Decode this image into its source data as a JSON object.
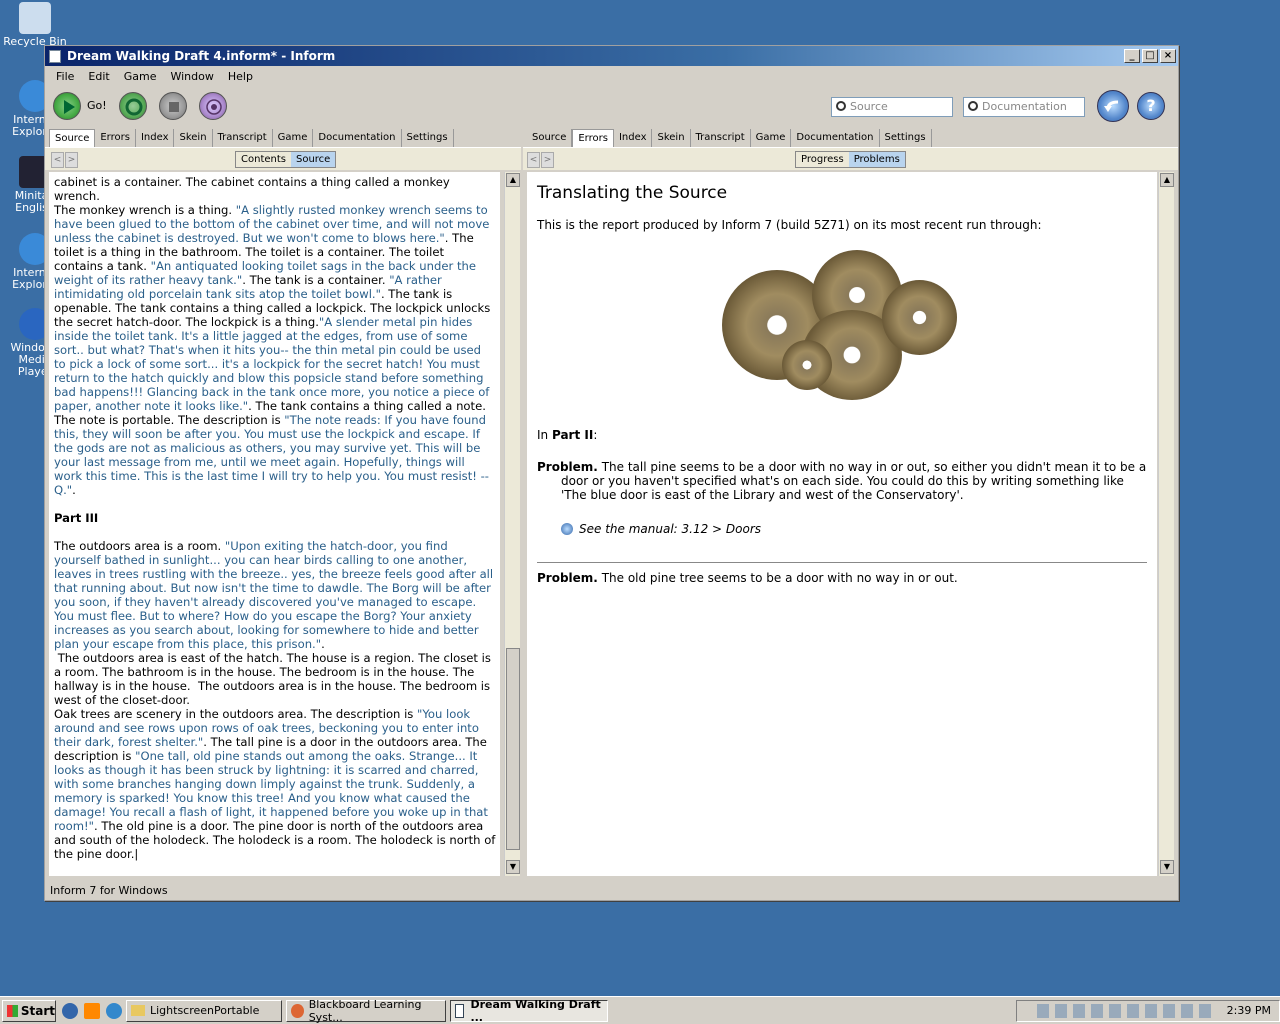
{
  "desktop": {
    "icons": [
      {
        "label": "Recycle Bin"
      },
      {
        "label": "Internet Explorer"
      },
      {
        "label": "Minitab English"
      },
      {
        "label": "Internet Explorer"
      },
      {
        "label": "Windows Media Player"
      }
    ]
  },
  "window": {
    "title": "Dream Walking Draft 4.inform* - Inform",
    "controls": {
      "minimize": "_",
      "maximize": "□",
      "close": "×"
    }
  },
  "menu": [
    "File",
    "Edit",
    "Game",
    "Window",
    "Help"
  ],
  "toolbar": {
    "go_label": "Go!",
    "search_source_placeholder": "Source",
    "search_docs_placeholder": "Documentation"
  },
  "left_pane": {
    "tabs": [
      "Source",
      "Errors",
      "Index",
      "Skein",
      "Transcript",
      "Game",
      "Documentation",
      "Settings"
    ],
    "active_tab": "Source",
    "segments": [
      "Contents",
      "Source"
    ],
    "active_segment": "Source"
  },
  "right_pane": {
    "tabs": [
      "Source",
      "Errors",
      "Index",
      "Skein",
      "Transcript",
      "Game",
      "Documentation",
      "Settings"
    ],
    "active_tab": "Errors",
    "segments": [
      "Progress",
      "Problems"
    ],
    "active_segment": "Problems"
  },
  "source_text": [
    {
      "t": "cabinet is a container. The cabinet contains a thing called a monkey wrench.\nThe monkey wrench is a thing. ",
      "q": false
    },
    {
      "t": "\"A slightly rusted monkey wrench seems to have been glued to the bottom of the cabinet over time, and will not move unless the cabinet is destroyed. But we won't come to blows here.\"",
      "q": true
    },
    {
      "t": ". The toilet is a thing in the bathroom. The toilet is a container. The toilet contains a tank. ",
      "q": false
    },
    {
      "t": "\"An antiquated looking toilet sags in the back under the weight of its rather heavy tank.\"",
      "q": true
    },
    {
      "t": ". The tank is a container. ",
      "q": false
    },
    {
      "t": "\"A rather intimidating old porcelain tank sits atop the toilet bowl.\"",
      "q": true
    },
    {
      "t": ". The tank is openable. The tank contains a thing called a lockpick. The lockpick unlocks the secret hatch-door. The lockpick is a thing.",
      "q": false
    },
    {
      "t": "\"A slender metal pin hides inside the toilet tank. It's a little jagged at the edges, from use of some sort.. but what? That's when it hits you-- the thin metal pin could be used to pick a lock of some sort... it's a lockpick for the secret hatch! You must return to the hatch quickly and blow this popsicle stand before something bad happens!!! Glancing back in the tank once more, you notice a piece of paper, another note it looks like.\"",
      "q": true
    },
    {
      "t": ". The tank contains a thing called a note. The note is portable. The description is ",
      "q": false
    },
    {
      "t": "\"The note reads: If you have found this, they will soon be after you. You must use the lockpick and escape. If the gods are not as malicious as others, you may survive yet. This will be your last message from me, until we meet again. Hopefully, things will work this time. This is the last time I will try to help you. You must resist! --Q.\"",
      "q": true
    },
    {
      "t": ".\n\n",
      "q": false
    },
    {
      "t": "Part III",
      "q": false,
      "b": true
    },
    {
      "t": "\n\nThe outdoors area is a room. ",
      "q": false
    },
    {
      "t": "\"Upon exiting the hatch-door, you find yourself bathed in sunlight... you can hear birds calling to one another, leaves in trees rustling with the breeze.. yes, the breeze feels good after all that running about. But now isn't the time to dawdle. The Borg will be after you soon, if they haven't already discovered you've managed to escape. You must flee. But to where? How do you escape the Borg? Your anxiety increases as you search about, looking for somewhere to hide and better plan your escape from this place, this prison.\"",
      "q": true
    },
    {
      "t": ".\n The outdoors area is east of the hatch. The house is a region. The closet is a room. The bathroom is in the house. The bedroom is in the house. The hallway is in the house.  The outdoors area is in the house. The bedroom is west of the closet-door.\nOak trees are scenery in the outdoors area. The description is ",
      "q": false
    },
    {
      "t": "\"You look around and see rows upon rows of oak trees, beckoning you to enter into their dark, forest shelter.\"",
      "q": true
    },
    {
      "t": ". The tall pine is a door in the outdoors area. The description is ",
      "q": false
    },
    {
      "t": "\"One tall, old pine stands out among the oaks. Strange... It looks as though it has been struck by lightning: it is scarred and charred, with some branches hanging down limply against the trunk. Suddenly, a memory is sparked! You know this tree! And you know what caused the damage! You recall a flash of light, it happened before you woke up in that room!\"",
      "q": true
    },
    {
      "t": ". The old pine is a door. The pine door is north of the outdoors area and south of the holodeck. The holodeck is a room. The holodeck is north of the pine door.|",
      "q": false
    }
  ],
  "report": {
    "title": "Translating the Source",
    "intro": "This is the report produced by Inform 7 (build 5Z71) on its most recent run through:",
    "in_part_prefix": "In ",
    "in_part_name": "Part II",
    "in_part_suffix": ":",
    "problem1_label": "Problem.",
    "problem1_text": " The tall pine seems to be a door with no way in or out, so either you didn't mean it to be a door or you haven't specified what's on each side. You could do this by writing something like 'The blue door is east of the Library and west of the Conservatory'.",
    "manual_link": "See the manual: 3.12 > Doors",
    "problem2_label": "Problem.",
    "problem2_text": " The old pine tree seems to be a door with no way in or out."
  },
  "status": {
    "text": "Inform 7 for Windows"
  },
  "taskbar": {
    "start": "Start",
    "tasks": [
      "LightscreenPortable",
      "Blackboard Learning Syst...",
      "Dream Walking Draft ..."
    ],
    "active_task": 2,
    "clock": "2:39 PM"
  }
}
